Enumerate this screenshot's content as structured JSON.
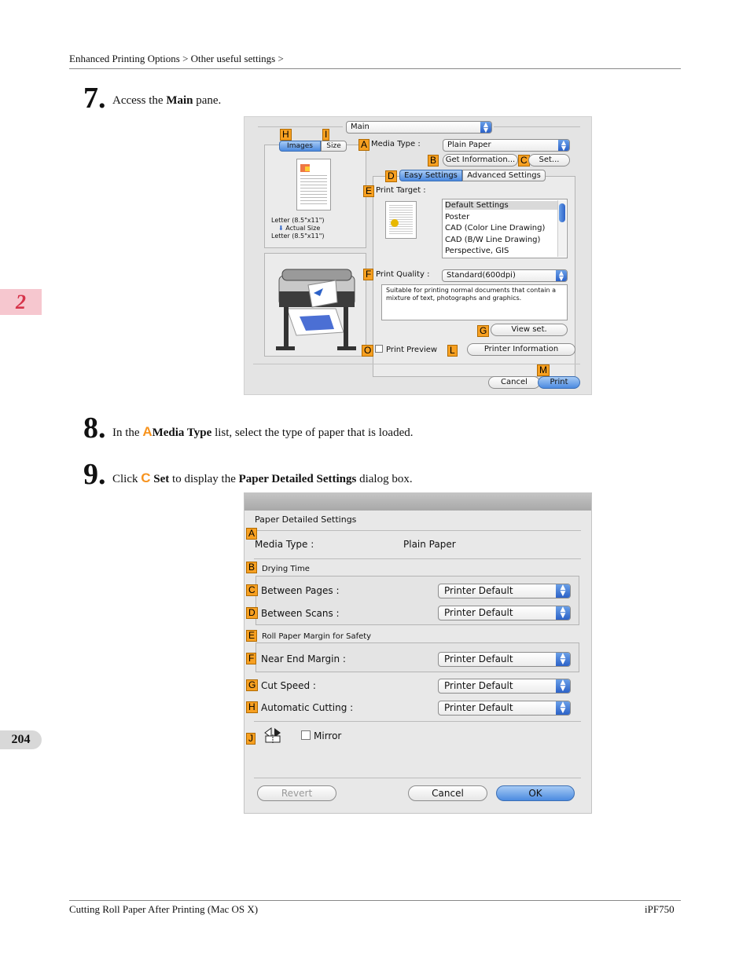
{
  "header": {
    "breadcrumb": "Enhanced Printing Options > Other useful settings >"
  },
  "chapter_tab": "2",
  "page_number": "204",
  "footer": {
    "left": "Cutting Roll Paper After Printing (Mac OS X)",
    "right": "iPF750"
  },
  "steps": [
    {
      "num": "7.",
      "pre": "Access the ",
      "bold": "Main",
      "post": " pane."
    },
    {
      "num": "8.",
      "pre": "In the ",
      "letter": "A",
      "bold": "Media Type",
      "post": " list, select the type of paper that is loaded."
    },
    {
      "num": "9.",
      "pre": "Click ",
      "letter": "C",
      "bold": "Set",
      "post": " to display the ",
      "bold2": "Paper Detailed Settings",
      "post2": " dialog box."
    }
  ],
  "main_dialog": {
    "pane_select": "Main",
    "tab_images": "Images",
    "tab_size": "Size",
    "letters": {
      "H": "H",
      "I": "I",
      "A": "A",
      "B": "B",
      "C": "C",
      "D": "D",
      "E": "E",
      "F": "F",
      "G": "G",
      "O": "O",
      "L": "L",
      "M": "M"
    },
    "preview_text1": "Letter (8.5\"x11\")",
    "preview_text2": "Actual Size",
    "preview_text3": "Letter (8.5\"x11\")",
    "media_type_label": "Media Type :",
    "media_type_value": "Plain Paper",
    "get_info_button": "Get Information...",
    "set_button": "Set...",
    "tab_easy": "Easy Settings",
    "tab_advanced": "Advanced Settings",
    "print_target_label": "Print Target :",
    "print_targets": [
      "Default Settings",
      "Poster",
      "CAD (Color Line Drawing)",
      "CAD (B/W Line Drawing)",
      "Perspective, GIS"
    ],
    "print_quality_label": "Print Quality :",
    "print_quality_value": "Standard(600dpi)",
    "quality_desc": "Suitable for printing normal documents that contain a mixture of text, photographs and graphics.",
    "view_set_button": "View set.",
    "print_preview_label": "Print Preview",
    "printer_info_button": "Printer Information",
    "cancel_button": "Cancel",
    "print_button": "Print"
  },
  "paper_dialog": {
    "title": "Paper Detailed Settings",
    "media_type_label": "Media Type :",
    "media_type_value": "Plain Paper",
    "drying_time_label": "Drying Time",
    "between_pages_label": "Between Pages :",
    "between_pages_value": "Printer Default",
    "between_scans_label": "Between Scans :",
    "between_scans_value": "Printer Default",
    "roll_margin_label": "Roll Paper Margin for Safety",
    "near_end_label": "Near End Margin :",
    "near_end_value": "Printer Default",
    "cut_speed_label": "Cut Speed :",
    "cut_speed_value": "Printer Default",
    "auto_cut_label": "Automatic Cutting :",
    "auto_cut_value": "Printer Default",
    "mirror_label": "Mirror",
    "revert_button": "Revert",
    "cancel_button": "Cancel",
    "ok_button": "OK",
    "letters": {
      "A": "A",
      "B": "B",
      "C": "C",
      "D": "D",
      "E": "E",
      "F": "F",
      "G": "G",
      "H": "H",
      "J": "J"
    }
  },
  "colors": {
    "accent_orange": "#f7a021",
    "chapter_pink": "#f6c7cf",
    "mac_blue": "#4b8ae0"
  }
}
